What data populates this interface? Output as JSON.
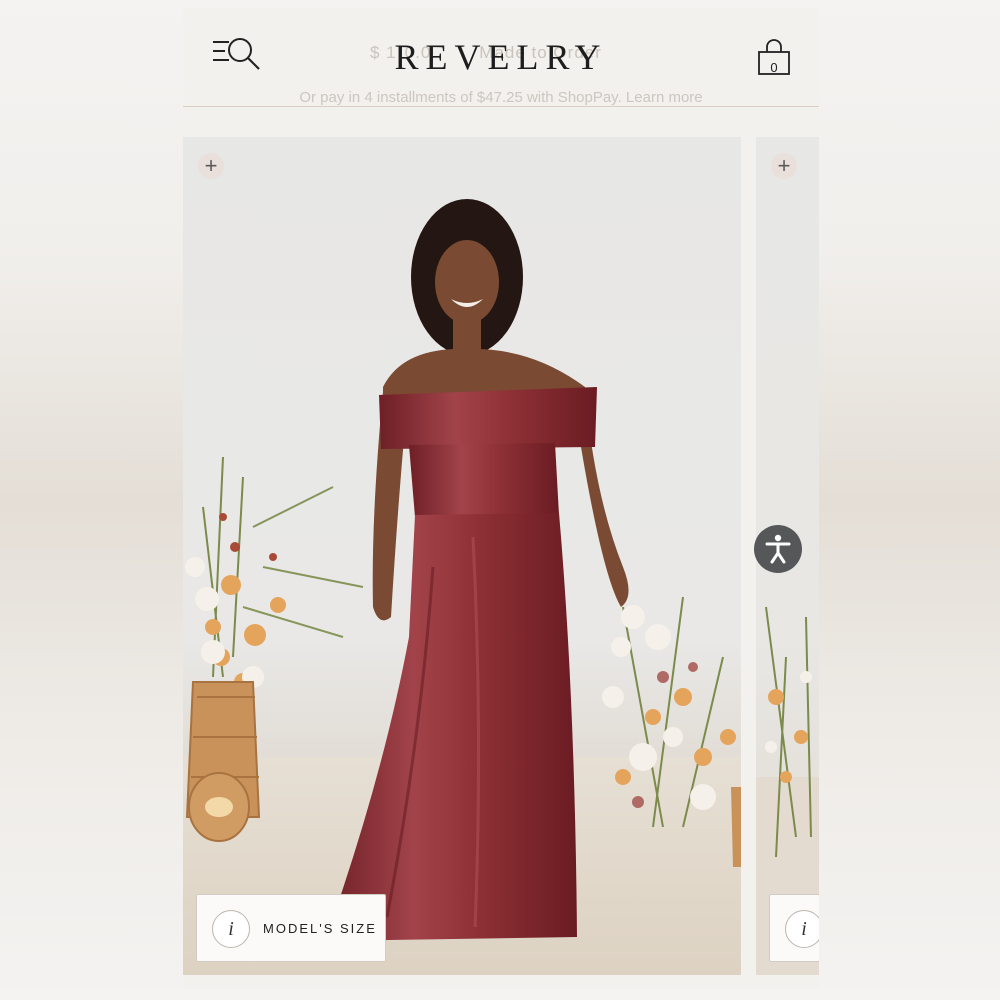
{
  "header": {
    "logo": "REVELRY",
    "price_behind": "$ 1",
    "price_behind_2": "0.0",
    "made_behind": "Made to Order",
    "cart_count": "0",
    "installments_text": "Or pay in 4 installments of $47.25 with ShopPay.",
    "learn_more": "Learn more"
  },
  "gallery": {
    "model_size_label": "MODEL'S SIZE",
    "info_glyph": "i",
    "plus_glyph": "+"
  },
  "icons": {
    "menu": "menu-search-icon",
    "cart": "shopping-bag-icon",
    "info": "info-icon",
    "accessibility": "accessibility-icon"
  },
  "colors": {
    "dress": "#8e3136",
    "background": "#f3f1ed",
    "accessibility_button": "#555759"
  }
}
